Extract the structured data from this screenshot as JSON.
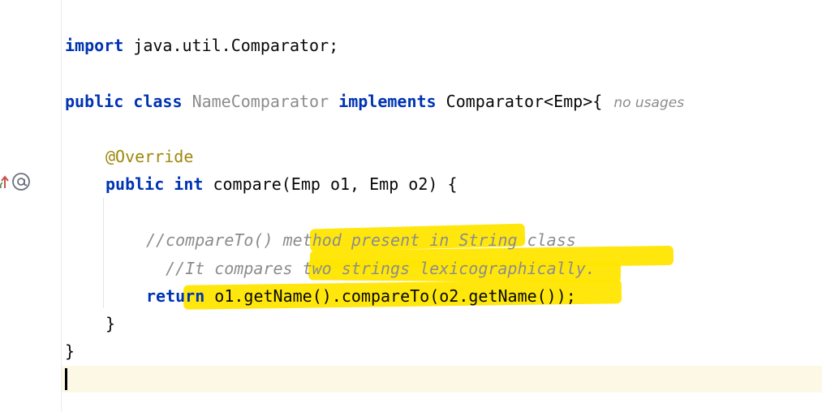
{
  "editor": {
    "lines": {
      "import_kw": "import",
      "import_rest": " java.util.Comparator;",
      "public_kw": "public",
      "class_kw": "class",
      "class_name": "NameComparator",
      "implements_kw": "implements",
      "implements_rest": " Comparator<Emp>{",
      "no_usages_hint": "no usages",
      "annotation": "@Override",
      "method_public": "public",
      "method_int": "int",
      "method_sig": " compare(Emp o1, Emp o2) {",
      "comment1": "//compareTo() method present in String class",
      "comment2": "//It compares two strings lexicographically.",
      "return_kw": "return",
      "return_expr": " o1.getName().compareTo(o2.getName());",
      "close_method": "}",
      "close_class": "}"
    },
    "gutter": {
      "override_icon": "override-up-arrow-icon",
      "at_icon": "at-sign-icon"
    },
    "highlight_color": "#ffe600"
  }
}
